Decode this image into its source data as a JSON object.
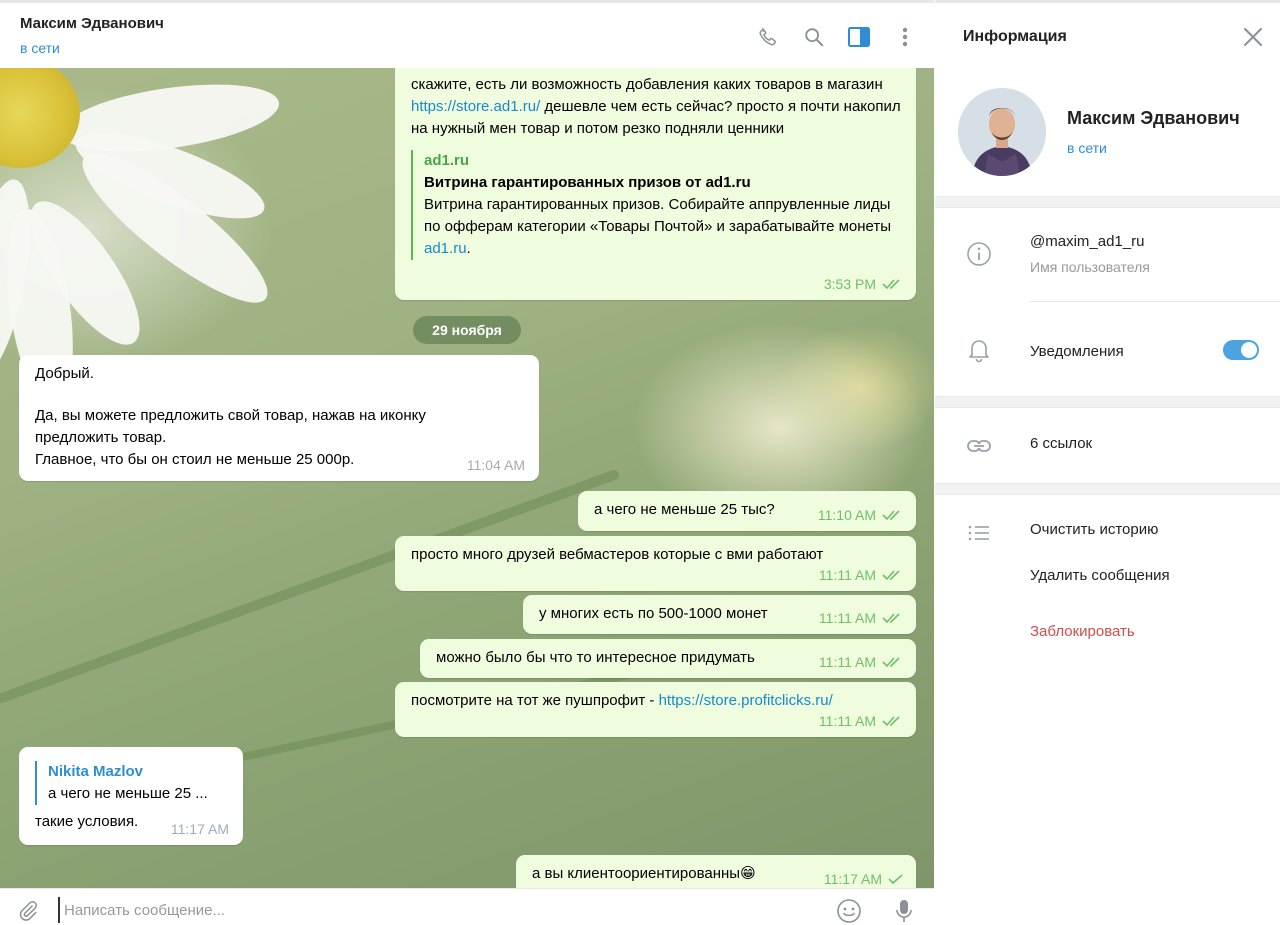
{
  "chat_header": {
    "title": "Максим Эдванович",
    "status": "в сети",
    "icons": [
      "phone-icon",
      "search-icon",
      "sidebar-toggle-icon",
      "more-vertical-icon"
    ]
  },
  "messages": {
    "m1": {
      "text_before_link": "скажите, есть ли возможность добавления каких товаров в магазин ",
      "link": "https://store.ad1.ru/",
      "text_after_link": " дешевле чем есть сейчас? просто я почти накопил на нужный мен товар и потом резко подняли ценники",
      "preview_site": "ad1.ru",
      "preview_title": "Витрина гарантированных призов от ad1.ru",
      "preview_desc": "Витрина гарантированных призов. Собирайте аппрувленные лиды по офферам категории «Товары Почтой» и зарабатывайте монеты ",
      "preview_link": "ad1.ru",
      "preview_end": ".",
      "time": "3:53 PM"
    },
    "date_separator": "29 ноября",
    "m2": {
      "line1": "Добрый.",
      "line2": "Да, вы можете предложить свой товар, нажав на иконку предложить товар.",
      "line3": "Главное, что бы он стоил не меньше 25 000р.",
      "time": "11:04 AM"
    },
    "m3": {
      "text": "а чего не меньше 25 тыс?",
      "time": "11:10 AM"
    },
    "m4": {
      "text": "просто много друзей вебмастеров которые с вми работают",
      "time": "11:11 AM"
    },
    "m5": {
      "text": "у многих есть по 500-1000 монет",
      "time": "11:11 AM"
    },
    "m6": {
      "text": "можно было бы что то интересное придумать",
      "time": "11:11 AM"
    },
    "m7": {
      "text": "посмотрите на тот же пушпрофит - ",
      "link": "https://store.profitclicks.ru/",
      "time": "11:11 AM"
    },
    "m8": {
      "reply_name": "Nikita Mazlov",
      "reply_text": "а чего не меньше 25 ...",
      "text": "такие условия.",
      "time": "11:17 AM"
    },
    "m9": {
      "text": "а вы клиентоориентированны",
      "emoji": "😁",
      "time": "11:17 AM"
    }
  },
  "composer": {
    "placeholder": "Написать сообщение...",
    "icons": [
      "attach-icon",
      "emoji-icon",
      "microphone-icon"
    ]
  },
  "info_panel": {
    "title": "Информация",
    "name": "Максим Эдванович",
    "status": "в сети",
    "username": "@maxim_ad1_ru",
    "username_label": "Имя пользователя",
    "notifications_label": "Уведомления",
    "notifications_enabled": true,
    "links": "6 ссылок",
    "clear_history": "Очистить историю",
    "delete_messages": "Удалить сообщения",
    "block": "Заблокировать"
  },
  "colors": {
    "accent": "#2f8dd6",
    "out_bubble": "#effdde",
    "check": "#6fbf69",
    "danger": "#d14e4e"
  }
}
